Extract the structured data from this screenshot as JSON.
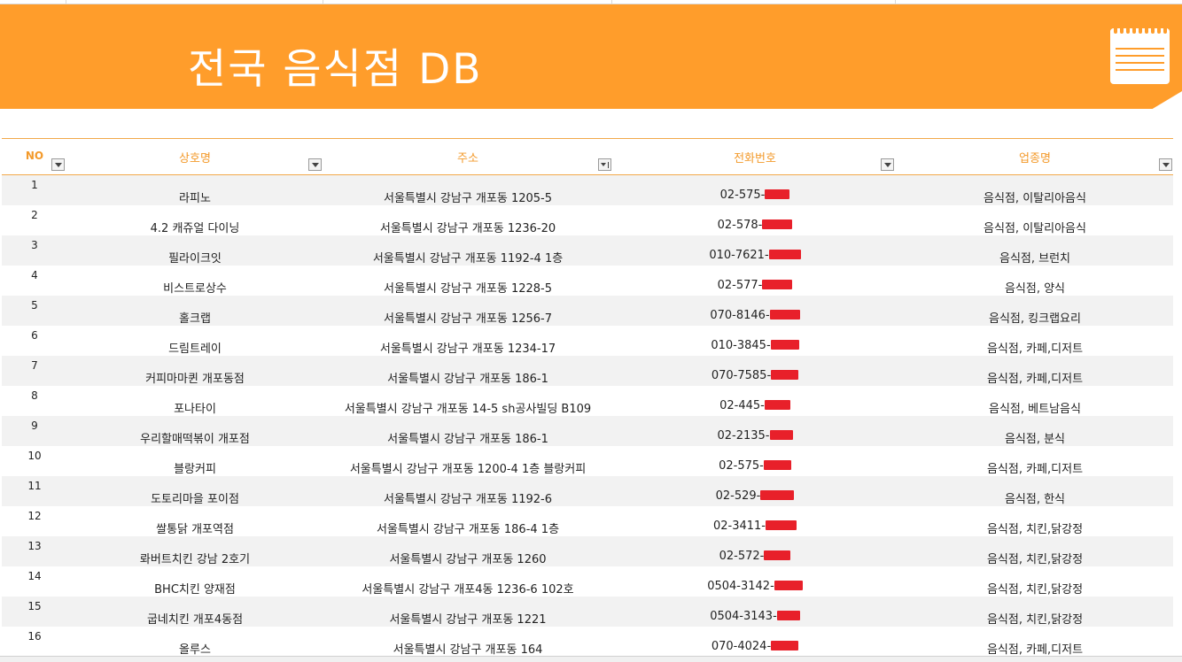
{
  "title": "전국 음식점 DB",
  "accent_color": "#ff9d2b",
  "header_icon": "notepad-icon",
  "columns": {
    "no": "NO",
    "name": "상호명",
    "address": "주소",
    "phone": "전화번호",
    "type": "업종명"
  },
  "rows": [
    {
      "no": "1",
      "name": "라피노",
      "address": "서울특별시 강남구 개포동 1205-5",
      "phone": "02-575-",
      "type": "음식점, 이탈리아음식"
    },
    {
      "no": "2",
      "name": "4.2 캐쥬얼 다이닝",
      "address": "서울특별시 강남구 개포동 1236-20",
      "phone": "02-578-",
      "type": "음식점, 이탈리아음식"
    },
    {
      "no": "3",
      "name": "필라이크잇",
      "address": "서울특별시 강남구 개포동 1192-4 1층",
      "phone": "010-7621-",
      "type": "음식점, 브런치"
    },
    {
      "no": "4",
      "name": "비스트로상수",
      "address": "서울특별시 강남구 개포동 1228-5",
      "phone": "02-577-",
      "type": "음식점, 양식"
    },
    {
      "no": "5",
      "name": "홀크랩",
      "address": "서울특별시 강남구 개포동 1256-7",
      "phone": "070-8146-",
      "type": "음식점, 킹크랩요리"
    },
    {
      "no": "6",
      "name": "드림트레이",
      "address": "서울특별시 강남구 개포동 1234-17",
      "phone": "010-3845-",
      "type": "음식점, 카페,디저트"
    },
    {
      "no": "7",
      "name": "커피마마퀸 개포동점",
      "address": "서울특별시 강남구 개포동 186-1",
      "phone": "070-7585-",
      "type": "음식점, 카페,디저트"
    },
    {
      "no": "8",
      "name": "포나타이",
      "address": "서울특별시 강남구 개포동 14-5 sh공사빌딩 B109",
      "phone": "02-445-",
      "type": "음식점, 베트남음식"
    },
    {
      "no": "9",
      "name": "우리할매떡볶이 개포점",
      "address": "서울특별시 강남구 개포동 186-1",
      "phone": "02-2135-",
      "type": "음식점, 분식"
    },
    {
      "no": "10",
      "name": "블랑커피",
      "address": "서울특별시 강남구 개포동 1200-4 1층 블랑커피",
      "phone": "02-575-",
      "type": "음식점, 카페,디저트"
    },
    {
      "no": "11",
      "name": "도토리마을 포이점",
      "address": "서울특별시 강남구 개포동 1192-6",
      "phone": "02-529-",
      "type": "음식점, 한식"
    },
    {
      "no": "12",
      "name": "쌀통닭 개포역점",
      "address": "서울특별시 강남구 개포동 186-4 1층",
      "phone": "02-3411-",
      "type": "음식점, 치킨,닭강정"
    },
    {
      "no": "13",
      "name": "롸버트치킨 강남 2호기",
      "address": "서울특별시 강남구 개포동 1260",
      "phone": "02-572-",
      "type": "음식점, 치킨,닭강정"
    },
    {
      "no": "14",
      "name": "BHC치킨 양재점",
      "address": "서울특별시 강남구 개포4동 1236-6 102호",
      "phone": "0504-3142-",
      "type": "음식점, 치킨,닭강정"
    },
    {
      "no": "15",
      "name": "굽네치킨 개포4동점",
      "address": "서울특별시 강남구 개포동 1221",
      "phone": "0504-3143-",
      "type": "음식점, 치킨,닭강정"
    },
    {
      "no": "16",
      "name": "올루스",
      "address": "서울특별시 강남구 개포동 164",
      "phone": "070-4024-",
      "type": "음식점, 카페,디저트"
    }
  ]
}
